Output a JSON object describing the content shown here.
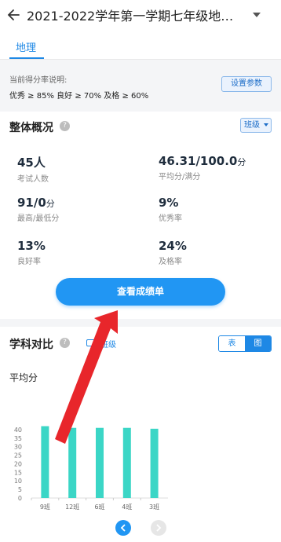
{
  "header": {
    "title": "2021-2022学年第一学期七年级地…"
  },
  "tabs": [
    {
      "label": "地理"
    }
  ],
  "rate": {
    "label": "当前得分率说明:",
    "values": "优秀 ≥ 85%  良好 ≥ 70%  及格 ≥ 60%",
    "param_button": "设置参数"
  },
  "overview": {
    "title": "整体概况",
    "class_select": "班级",
    "stats": [
      {
        "value": "45人",
        "unit": "",
        "label": "考试人数"
      },
      {
        "value": "46.31/100.0",
        "unit": "分",
        "label": "平均分/满分"
      },
      {
        "value": "91/0",
        "unit": "分",
        "label": "最高/最低分"
      },
      {
        "value": "9%",
        "unit": "",
        "label": "优秀率"
      },
      {
        "value": "13%",
        "unit": "",
        "label": "良好率"
      },
      {
        "value": "24%",
        "unit": "",
        "label": "及格率"
      }
    ],
    "cta": "查看成绩单"
  },
  "compare": {
    "title": "学科对比",
    "legend": "班级",
    "segment": {
      "table": "表",
      "chart": "图"
    },
    "subtitle": "平均分"
  },
  "chart_data": {
    "type": "bar",
    "title": "平均分",
    "categories": [
      "9班",
      "12班",
      "6班",
      "4班",
      "3班"
    ],
    "values": [
      42,
      41,
      41,
      41,
      40.5
    ],
    "ylim": [
      0,
      45
    ],
    "yticks": [
      0,
      5,
      10,
      15,
      20,
      25,
      30,
      35,
      40
    ],
    "bar_color": "#3bd6c6",
    "grid": false
  },
  "colors": {
    "accent": "#2196f3",
    "bar": "#3bd6c6",
    "arrow": "#e8262b"
  }
}
